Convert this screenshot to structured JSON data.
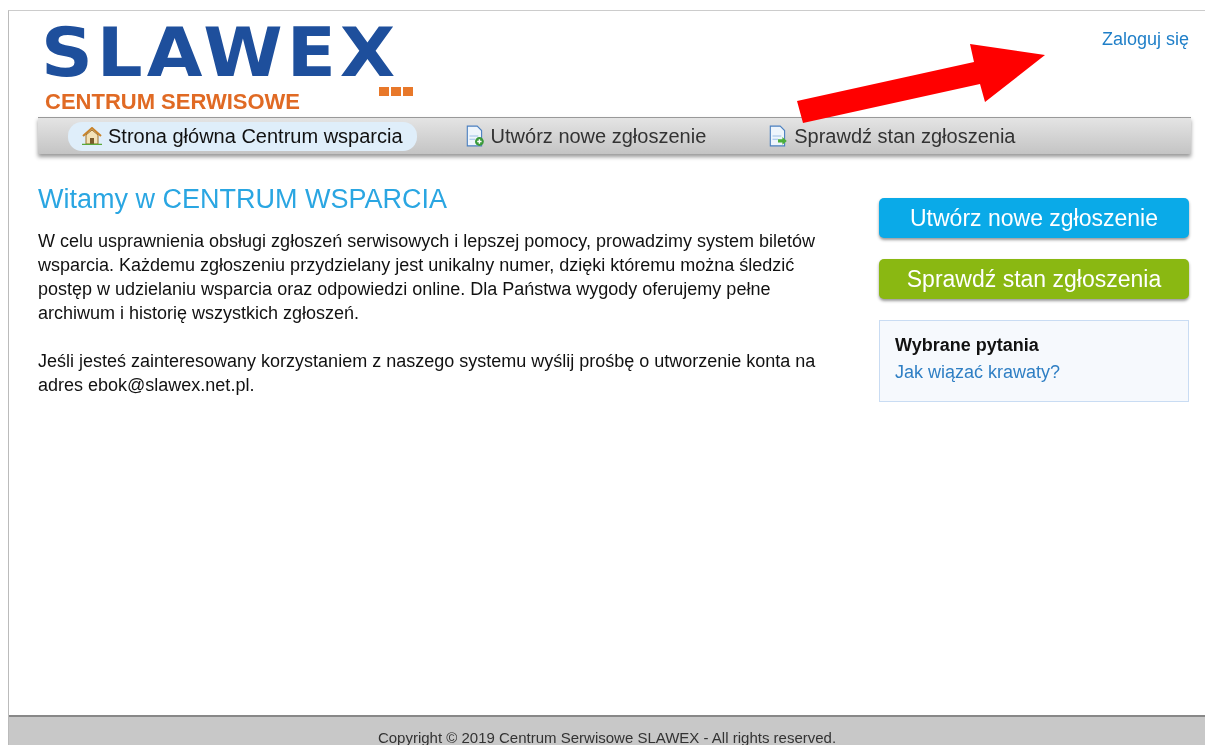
{
  "logo": {
    "name": "SLAWEX",
    "subtitle": "CENTRUM SERWISOWE"
  },
  "login_link": "Zaloguj się",
  "nav": [
    {
      "label": "Strona główna Centrum wsparcia",
      "kind": "home",
      "selected": true
    },
    {
      "label": "Utwórz nowe zgłoszenie",
      "kind": "new",
      "selected": false
    },
    {
      "label": "Sprawdź stan zgłoszenia",
      "kind": "check",
      "selected": false
    }
  ],
  "heading": "Witamy w CENTRUM WSPARCIA",
  "paragraphs": [
    "W celu usprawnienia obsługi zgłoszeń serwisowych i lepszej pomocy, prowadzimy system biletów wsparcia. Każdemu zgłoszeniu przydzielany jest unikalny numer, dzięki któremu można śledzić postęp w udzielaniu wsparcia oraz odpowiedzi online. Dla Państwa wygody oferujemy pełne archiwum i historię wszystkich zgłoszeń.",
    "Jeśli jesteś zainteresowany korzystaniem z naszego systemu wyślij prośbę o utworzenie konta na adres ebok@slawex.net.pl."
  ],
  "buttons": [
    {
      "label": "Utwórz nowe zgłoszenie",
      "kind": "new"
    },
    {
      "label": "Sprawdź stan zgłoszenia",
      "kind": "check"
    }
  ],
  "faq": {
    "title": "Wybrane pytania",
    "links": [
      "Jak wiązać krawaty?"
    ]
  },
  "footer": "Copyright © 2019 Centrum Serwisowe SLAWEX - All rights reserved."
}
